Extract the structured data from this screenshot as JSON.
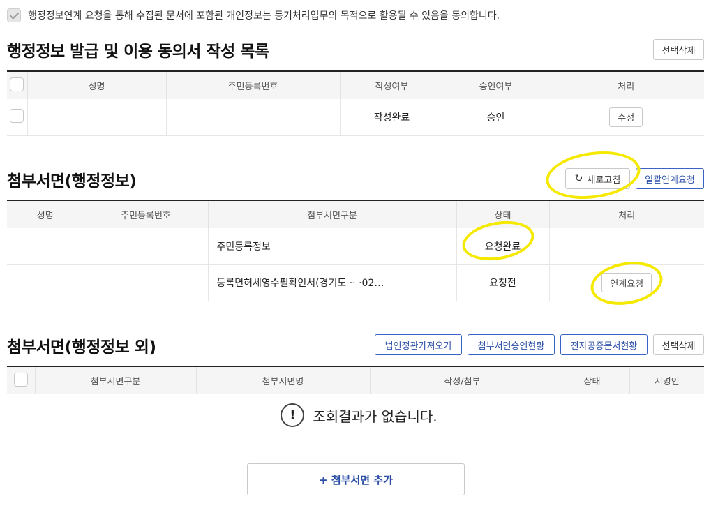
{
  "consent": {
    "text": "행정정보연계 요청을 통해 수집된 문서에 포함된 개인정보는 등기처리업무의 목적으로 활용될 수 있음을 동의합니다."
  },
  "section1": {
    "title": "행정정보 발급 및 이용 동의서 작성 목록",
    "delete_button": "선택삭제",
    "columns": [
      "성명",
      "주민등록번호",
      "작성여부",
      "승인여부",
      "처리"
    ],
    "row": {
      "name": "",
      "resident_no": "",
      "written": "작성완료",
      "approved": "승인",
      "action": "수정"
    }
  },
  "section2": {
    "title": "첨부서면(행정정보)",
    "refresh_button": "새로고침",
    "batch_request_button": "일괄연계요청",
    "columns": [
      "성명",
      "주민등록번호",
      "첨부서면구분",
      "상태",
      "처리"
    ],
    "rows": [
      {
        "name": "",
        "resident_no": "",
        "type": "주민등록정보",
        "status": "요청완료",
        "action": ""
      },
      {
        "name": "",
        "resident_no": "",
        "type": "등록면허세영수필확인서(경기도 ·· ·02…",
        "status": "요청전",
        "action": "연계요청"
      }
    ]
  },
  "section3": {
    "title": "첨부서면(행정정보 외)",
    "buttons": [
      "법인정관가져오기",
      "첨부서면승인현황",
      "전자공증문서현황",
      "선택삭제"
    ],
    "columns": [
      "첨부서면구분",
      "첨부서면명",
      "작성/첨부",
      "상태",
      "서명인"
    ],
    "empty_text": "조회결과가 없습니다.",
    "empty_icon": "!"
  },
  "add_button": "+ 첨부서면 추가",
  "colors": {
    "highlight": "#f5e900",
    "accent": "#2c4fa8"
  }
}
